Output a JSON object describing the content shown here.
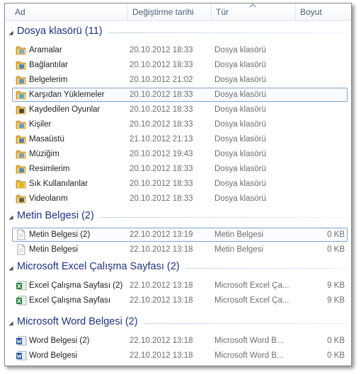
{
  "columns": {
    "name": "Ad",
    "date": "Değiştirme tarihi",
    "type": "Tür",
    "size": "Boyut"
  },
  "icons": {
    "group_chevron": "chevron-down-icon",
    "folder": "folder-icon",
    "text_doc": "text-document-icon",
    "excel": "excel-file-icon",
    "word": "word-file-icon"
  },
  "colors": {
    "group_title": "#1e3287",
    "header_text": "#4c607a",
    "highlight_border": "#7da2ce",
    "folder_yellow": "#e8c15a"
  },
  "groups": [
    {
      "title": "Dosya klasörü (11)",
      "items": [
        {
          "name": "Aramalar",
          "date": "20.10.2012 18:33",
          "type": "Dosya klasörü",
          "size": "",
          "icon": "search-folder-icon"
        },
        {
          "name": "Bağlantılar",
          "date": "20.10.2012 18:33",
          "type": "Dosya klasörü",
          "size": "",
          "icon": "links-folder-icon"
        },
        {
          "name": "Belgelerim",
          "date": "20.10.2012 21:02",
          "type": "Dosya klasörü",
          "size": "",
          "icon": "documents-folder-icon"
        },
        {
          "name": "Karşıdan Yüklemeler",
          "date": "20.10.2012 18:33",
          "type": "Dosya klasörü",
          "size": "",
          "icon": "downloads-folder-icon"
        },
        {
          "name": "Kaydedilen Oyunlar",
          "date": "20.10.2012 18:33",
          "type": "Dosya klasörü",
          "size": "",
          "icon": "saved-games-folder-icon"
        },
        {
          "name": "Kişiler",
          "date": "20.10.2012 18:33",
          "type": "Dosya klasörü",
          "size": "",
          "icon": "contacts-folder-icon"
        },
        {
          "name": "Masaüstü",
          "date": "21.10.2012 21:13",
          "type": "Dosya klasörü",
          "size": "",
          "icon": "desktop-folder-icon"
        },
        {
          "name": "Müziğim",
          "date": "20.10.2012 19:43",
          "type": "Dosya klasörü",
          "size": "",
          "icon": "music-folder-icon"
        },
        {
          "name": "Resimlerim",
          "date": "20.10.2012 18:33",
          "type": "Dosya klasörü",
          "size": "",
          "icon": "pictures-folder-icon"
        },
        {
          "name": "Sık Kullanılanlar",
          "date": "20.10.2012 18:33",
          "type": "Dosya klasörü",
          "size": "",
          "icon": "favorites-folder-icon"
        },
        {
          "name": "Videolarım",
          "date": "20.10.2012 18:33",
          "type": "Dosya klasörü",
          "size": "",
          "icon": "videos-folder-icon"
        }
      ]
    },
    {
      "title": "Metin Belgesi (2)",
      "items": [
        {
          "name": "Metin Belgesi (2)",
          "date": "22.10.2012 13:19",
          "type": "Metin Belgesi",
          "size": "0 KB",
          "icon": "text-document-icon"
        },
        {
          "name": "Metin Belgesi",
          "date": "22.10.2012 13:18",
          "type": "Metin Belgesi",
          "size": "0 KB",
          "icon": "text-document-icon"
        }
      ]
    },
    {
      "title": "Microsoft Excel Çalışma Sayfası (2)",
      "items": [
        {
          "name": "Excel Çalışma Sayfası (2)",
          "date": "22.10.2012 13:18",
          "type": "Microsoft Excel Ça...",
          "size": "9 KB",
          "icon": "excel-file-icon"
        },
        {
          "name": "Excel Çalışma Sayfası",
          "date": "22.10.2012 13:18",
          "type": "Microsoft Excel Ça...",
          "size": "9 KB",
          "icon": "excel-file-icon"
        }
      ]
    },
    {
      "title": "Microsoft Word Belgesi (2)",
      "items": [
        {
          "name": "Word Belgesi (2)",
          "date": "22.10.2012 13:18",
          "type": "Microsoft Word B...",
          "size": "0 KB",
          "icon": "word-file-icon"
        },
        {
          "name": "Word Belgesi",
          "date": "22.10.2012 13:18",
          "type": "Microsoft Word B...",
          "size": "0 KB",
          "icon": "word-file-icon"
        }
      ]
    }
  ]
}
